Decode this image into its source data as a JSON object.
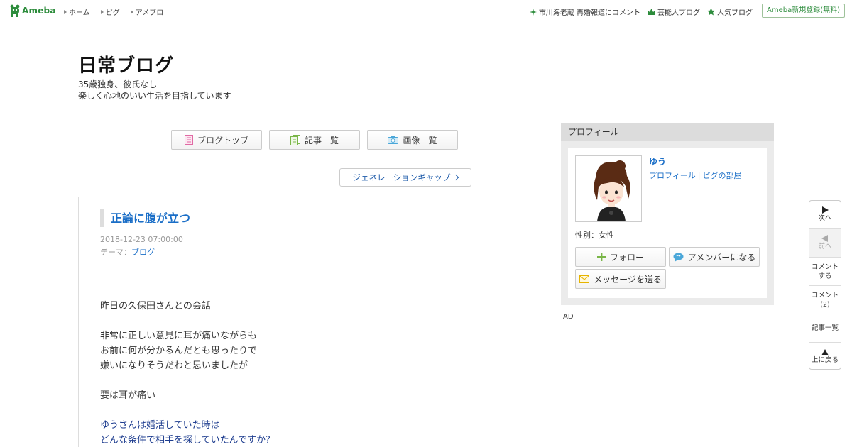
{
  "topbar": {
    "logo_text": "Ameba",
    "nav": [
      "ホーム",
      "ピグ",
      "アメブロ"
    ],
    "right_links": [
      "市川海老蔵 再婚報道にコメント",
      "芸能人ブログ",
      "人気ブログ"
    ],
    "signup": "Ameba新規登録(無料)",
    "brand_color": "#2d8c3c"
  },
  "blog": {
    "title": "日常ブログ",
    "desc_line1": "35歳独身、彼氏なし",
    "desc_line2": "楽しく心地のいい生活を目指しています"
  },
  "nav_buttons": {
    "blog_top": "ブログトップ",
    "entries": "記事一覧",
    "images": "画像一覧"
  },
  "next_entry_link": "ジェネレーションギャップ",
  "article": {
    "title": "正論に腹が立つ",
    "date": "2018-12-23 07:00:00",
    "theme_label": "テーマ：",
    "theme": "ブログ",
    "lines": [
      "昨日の久保田さんとの会話",
      "",
      "非常に正しい意見に耳が痛いながらも",
      "お前に何が分かるんだとも思ったりで",
      "嫌いになりそうだわと思いましたが",
      "",
      "要は耳が痛い",
      ""
    ],
    "blue_lines": [
      "ゆうさんは婚活していた時は",
      "どんな条件で相手を探していたんですか？"
    ],
    "link_color": "#1a6ec7"
  },
  "profile": {
    "header": "プロフィール",
    "name": "ゆう",
    "link_profile": "プロフィール",
    "link_sep": "|",
    "link_room": "ピグの部屋",
    "gender": "性別：女性",
    "follow": "フォロー",
    "amember": "アメンバーになる",
    "message": "メッセージを送る"
  },
  "ad_label": "AD",
  "side_nav": {
    "next": "次へ",
    "prev": "前へ",
    "comment_l1": "コメント",
    "comment_l2": "する",
    "comments_l1": "コメント",
    "comments_l2": "(2)",
    "entries": "記事一覧",
    "top": "上に戻る"
  }
}
